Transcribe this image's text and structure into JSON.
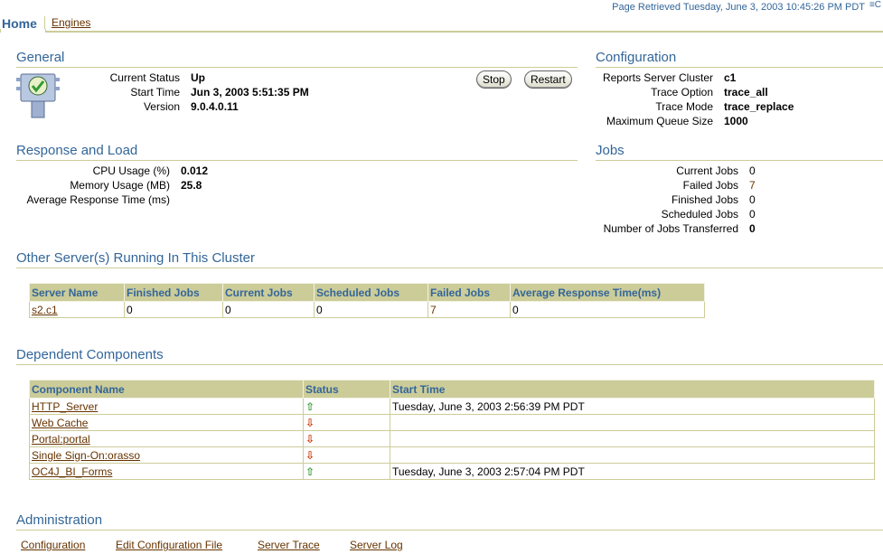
{
  "header": {
    "retrieved": "Page Retrieved Tuesday, June 3, 2003 10:45:26 PM PDT",
    "help_glyph": "≡C"
  },
  "tabs": [
    {
      "label": "Home",
      "active": true
    },
    {
      "label": "Engines",
      "active": false
    }
  ],
  "general": {
    "title": "General",
    "rows": [
      {
        "label": "Current Status",
        "value": "Up"
      },
      {
        "label": "Start Time",
        "value": "Jun 3, 2003 5:51:35 PM"
      },
      {
        "label": "Version",
        "value": "9.0.4.0.11"
      }
    ],
    "stop_label": "Stop",
    "restart_label": "Restart",
    "status_icon": "status-up-icon"
  },
  "configuration": {
    "title": "Configuration",
    "rows": [
      {
        "label": "Reports Server Cluster",
        "value": "c1"
      },
      {
        "label": "Trace Option",
        "value": "trace_all"
      },
      {
        "label": "Trace Mode",
        "value": "trace_replace"
      },
      {
        "label": "Maximum Queue Size",
        "value": "1000"
      }
    ]
  },
  "response_load": {
    "title": "Response and Load",
    "rows": [
      {
        "label": "CPU Usage (%)",
        "value": "0.012"
      },
      {
        "label": "Memory Usage (MB)",
        "value": "25.8"
      },
      {
        "label": "Average Response Time (ms)",
        "value": ""
      }
    ]
  },
  "jobs": {
    "title": "Jobs",
    "rows": [
      {
        "label": "Current Jobs",
        "value": "0"
      },
      {
        "label": "Failed Jobs",
        "value": "7"
      },
      {
        "label": "Finished Jobs",
        "value": "0"
      },
      {
        "label": "Scheduled Jobs",
        "value": "0"
      },
      {
        "label": "Number of Jobs Transferred",
        "value": "0"
      }
    ]
  },
  "other_servers": {
    "title": "Other Server(s) Running In This Cluster",
    "columns": [
      "Server Name",
      "Finished Jobs",
      "Current Jobs",
      "Scheduled Jobs",
      "Failed Jobs",
      "Average Response Time(ms)"
    ],
    "rows": [
      [
        "s2.c1",
        "0",
        "0",
        "0",
        "7",
        "0"
      ]
    ]
  },
  "dependent": {
    "title": "Dependent Components",
    "columns": [
      "Component Name",
      "Status",
      "Start Time"
    ],
    "rows": [
      {
        "name": "HTTP_Server",
        "status": "up",
        "status_glyph": "⇧",
        "start": "Tuesday, June 3, 2003 2:56:39 PM PDT"
      },
      {
        "name": "Web Cache",
        "status": "down",
        "status_glyph": "⇩",
        "start": ""
      },
      {
        "name": "Portal:portal",
        "status": "down",
        "status_glyph": "⇩",
        "start": ""
      },
      {
        "name": "Single Sign-On:orasso",
        "status": "down",
        "status_glyph": "⇩",
        "start": ""
      },
      {
        "name": "OC4J_BI_Forms",
        "status": "up",
        "status_glyph": "⇧",
        "start": "Tuesday, June 3, 2003 2:57:04 PM PDT"
      }
    ]
  },
  "administration": {
    "title": "Administration",
    "links": [
      "Configuration",
      "Edit Configuration File",
      "Server Trace",
      "Server Log"
    ]
  }
}
